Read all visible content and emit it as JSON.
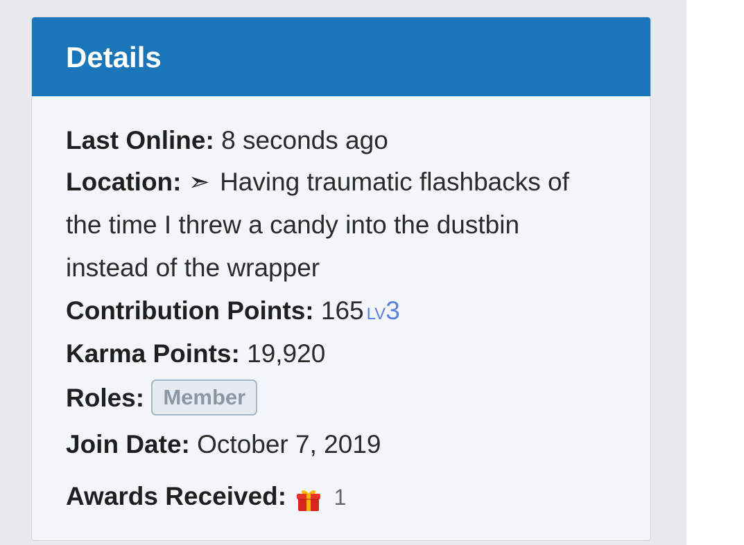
{
  "card": {
    "title": "Details"
  },
  "details": {
    "last_online": {
      "label": "Last Online:",
      "value": "8 seconds ago"
    },
    "location": {
      "label": "Location:",
      "arrow": "➣",
      "lines": [
        "Having traumatic flashbacks of",
        "the time I threw a candy into the dustbin",
        "instead of the wrapper"
      ]
    },
    "contribution_points": {
      "label": "Contribution Points:",
      "value": "165",
      "level_prefix": "LV",
      "level": "3"
    },
    "karma_points": {
      "label": "Karma Points:",
      "value": "19,920"
    },
    "roles": {
      "label": "Roles:",
      "badge": "Member"
    },
    "join_date": {
      "label": "Join Date:",
      "value": "October 7, 2019"
    },
    "awards": {
      "label": "Awards Received:",
      "icon": "gift-icon",
      "count": "1"
    }
  },
  "colors": {
    "header_bg": "#1a76b8",
    "card_bg": "#f2f6fa",
    "level_accent": "#5a7fd8"
  }
}
